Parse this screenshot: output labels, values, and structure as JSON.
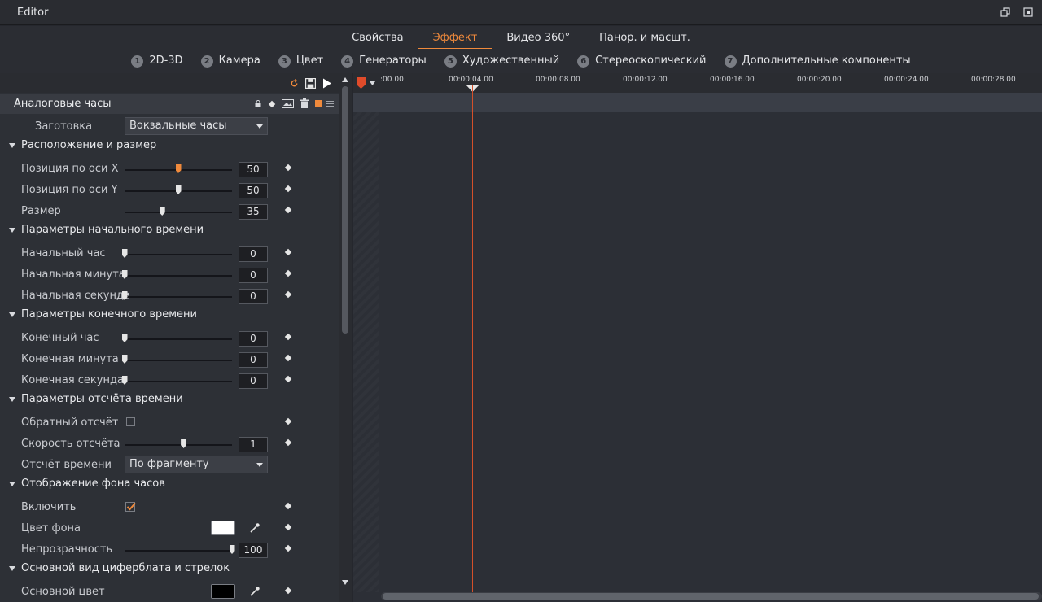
{
  "window": {
    "title": "Editor"
  },
  "tabs": [
    {
      "label": "Свойства",
      "active": false
    },
    {
      "label": "Эффект",
      "active": true
    },
    {
      "label": "Видео 360°",
      "active": false
    },
    {
      "label": "Панор. и масшт.",
      "active": false
    }
  ],
  "subtabs": [
    {
      "num": "1",
      "label": "2D-3D"
    },
    {
      "num": "2",
      "label": "Камера"
    },
    {
      "num": "3",
      "label": "Цвет"
    },
    {
      "num": "4",
      "label": "Генераторы"
    },
    {
      "num": "5",
      "label": "Художественный"
    },
    {
      "num": "6",
      "label": "Стереоскопический"
    },
    {
      "num": "7",
      "label": "Дополнительные компоненты"
    }
  ],
  "panel": {
    "title": "Аналоговые часы",
    "preset_label": "Заготовка",
    "preset_value": "Вокзальные часы",
    "sections": {
      "s1": "Расположение и размер",
      "s2": "Параметры начального времени",
      "s3": "Параметры конечного времени",
      "s4": "Параметры отсчёта времени",
      "s5": "Отображение фона часов",
      "s6": "Основной вид циферблата и стрелок"
    },
    "params": {
      "pos_x": {
        "label": "Позиция по оси X",
        "value": "50",
        "fraction": 0.5
      },
      "pos_y": {
        "label": "Позиция по оси Y",
        "value": "50",
        "fraction": 0.5
      },
      "size": {
        "label": "Размер",
        "value": "35",
        "fraction": 0.35
      },
      "start_hour": {
        "label": "Начальный час",
        "value": "0",
        "fraction": 0
      },
      "start_min": {
        "label": "Начальная минута",
        "value": "0",
        "fraction": 0
      },
      "start_sec": {
        "label": "Начальная секунда",
        "value": "0",
        "fraction": 0
      },
      "end_hour": {
        "label": "Конечный час",
        "value": "0",
        "fraction": 0
      },
      "end_min": {
        "label": "Конечная минута",
        "value": "0",
        "fraction": 0
      },
      "end_sec": {
        "label": "Конечная секунда",
        "value": "0",
        "fraction": 0
      },
      "countdown": {
        "label": "Обратный отсчёт",
        "checked": false
      },
      "speed": {
        "label": "Скорость отсчёта",
        "value": "1",
        "fraction": 0.55
      },
      "time_mode": {
        "label": "Отсчёт времени",
        "value": "По фрагменту"
      },
      "enable": {
        "label": "Включить",
        "checked": true
      },
      "bg_color": {
        "label": "Цвет фона",
        "color": "#ffffff"
      },
      "opacity": {
        "label": "Непрозрачность",
        "value": "100",
        "fraction": 1
      },
      "main_color": {
        "label": "Основной цвет",
        "color": "#000000"
      }
    }
  },
  "timeline": {
    "ticks": [
      ":00.00",
      "00:00:04.00",
      "00:00:08.00",
      "00:00:12.00",
      "00:00:16.00",
      "00:00:20.00",
      "00:00:24.00",
      "00:00:28.00"
    ],
    "playhead_time": "00:00:04.00"
  },
  "colors": {
    "accent": "#f08a3c",
    "playhead": "#d4502a"
  },
  "icons": [
    "restore-window-icon",
    "popout-window-icon",
    "reset-icon",
    "save-icon",
    "play-icon",
    "lock-icon",
    "keyframe-icon",
    "preview-icon",
    "trash-icon",
    "color-square-icon",
    "menu-icon",
    "eyedropper-icon",
    "playhead-marker-icon"
  ]
}
